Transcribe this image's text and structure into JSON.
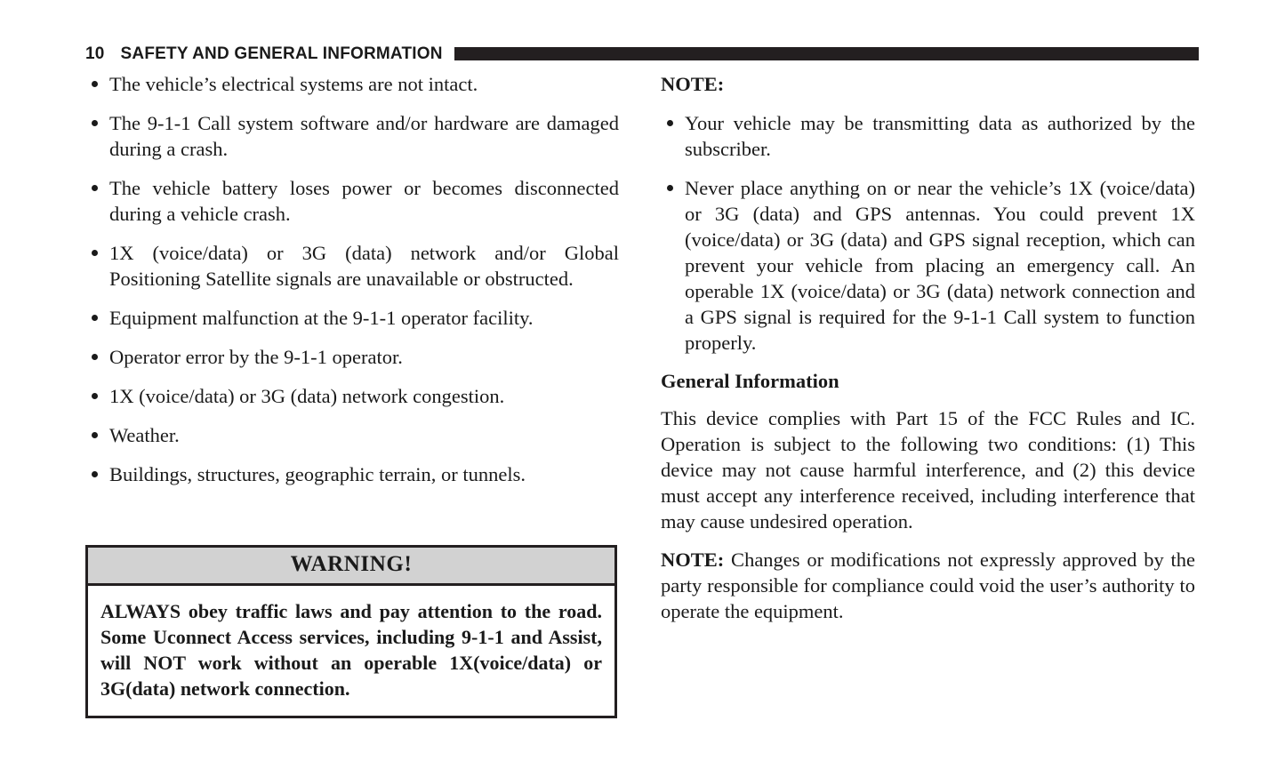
{
  "header": {
    "page_number": "10",
    "title": "SAFETY AND GENERAL INFORMATION",
    "rule_color": "#231f20"
  },
  "left_column": {
    "bullets": [
      "The vehicle’s electrical systems are not intact.",
      "The 9-1-1 Call system software and/or hardware are damaged during a crash.",
      "The vehicle battery loses power or becomes disconnected during a vehicle crash.",
      "1X (voice/data) or 3G (data) network and/or Global Positioning Satellite signals are unavailable or obstructed.",
      "Equipment malfunction at the 9-1-1 operator facility.",
      "Operator error by the 9-1-1 operator.",
      "1X (voice/data) or 3G (data) network congestion.",
      "Weather.",
      "Buildings, structures, geographic terrain, or tunnels."
    ],
    "warning": {
      "title": "WARNING!",
      "body": "ALWAYS obey traffic laws and pay attention to the road. Some Uconnect Access services, including 9-1-1 and Assist, will NOT work without an operable 1X(voice/data) or 3G(data) network connection.",
      "header_background": "#d2d2d2",
      "border_color": "#231f20"
    }
  },
  "right_column": {
    "note_heading": "NOTE:",
    "note_bullets": [
      "Your vehicle may be transmitting data as authorized by the subscriber.",
      "Never place anything on or near the vehicle’s 1X (voice/data) or 3G (data) and GPS antennas. You could prevent 1X (voice/data) or 3G (data) and GPS signal reception, which can prevent your vehicle from placing an emergency call. An operable 1X (voice/data) or 3G (data) network connection and a GPS signal is required for the 9-1-1 Call system to function properly."
    ],
    "general_information_heading": "General Information",
    "fcc_paragraph": "This device complies with Part 15 of the FCC Rules and IC. Operation is subject to the following two conditions: (1) This device may not cause harmful interference, and (2) this device must accept any interference received, including interference that may cause undesired operation.",
    "final_note_label": "NOTE:",
    "final_note_text": " Changes or modifications not expressly approved by the party responsible for compliance could void the user’s authority to operate the equipment."
  }
}
